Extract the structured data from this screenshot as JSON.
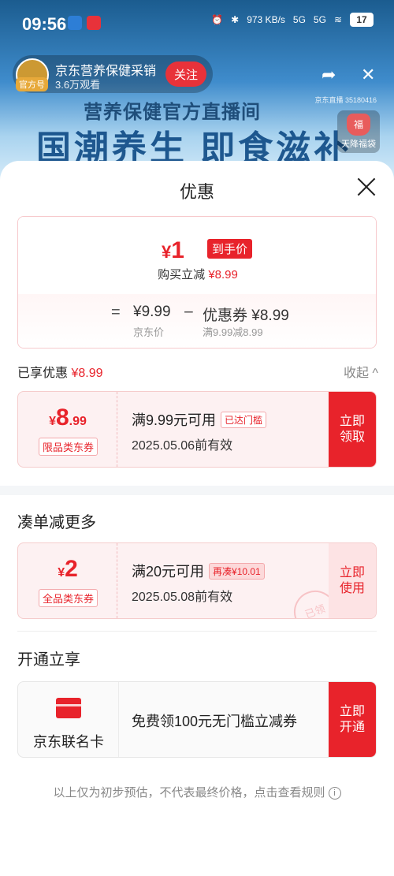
{
  "status": {
    "time": "09:56",
    "net_speed": "973 KB/s",
    "sig1": "5G",
    "sig2": "5G",
    "battery": "17"
  },
  "stream": {
    "official_badge": "官方号",
    "name": "京东营养保健采销",
    "viewers": "3.6万观看",
    "follow": "关注",
    "channel_id": "京东直播 35180416",
    "banner_sub": "营养保健官方直播间",
    "banner_main": "国潮养生 即食滋补",
    "lucky_bag_glyph": "福",
    "lucky_bag_label": "天降福袋"
  },
  "sheet": {
    "title": "优惠",
    "final_price": {
      "currency": "¥",
      "value": "1",
      "tag": "到手价"
    },
    "instant_label": "购买立减",
    "instant_amount": "¥8.99",
    "eq": "=",
    "jd_price": "¥9.99",
    "jd_label": "京东价",
    "minus": "−",
    "coupon_amount": "优惠券 ¥8.99",
    "coupon_cond": "满9.99减8.99",
    "enjoyed_label": "已享优惠",
    "enjoyed_amount": "¥8.99",
    "collapse": "收起 ^"
  },
  "coupon1": {
    "cur": "¥",
    "big": "8",
    "dec": ".99",
    "type": "限品类东券",
    "cond": "满9.99元可用",
    "tag": "已达门槛",
    "valid": "2025.05.06前有效",
    "btn": "立即领取"
  },
  "section2": {
    "title": "凑单减更多"
  },
  "coupon2": {
    "cur": "¥",
    "big": "2",
    "dec": "",
    "type": "全品类东券",
    "cond": "满20元可用",
    "tag": "再凑¥10.01",
    "valid": "2025.05.08前有效",
    "btn": "立即使用",
    "stamp": "已领"
  },
  "section3": {
    "title": "开通立享"
  },
  "card_offer": {
    "name": "京东联名卡",
    "desc": "免费领100元无门槛立减券",
    "btn": "立即开通"
  },
  "footer": {
    "note": "以上仅为初步预估，不代表最终价格，点击查看规则",
    "info_glyph": "i"
  },
  "colors": {
    "accent": "#e8232b",
    "pink_bg": "#fdf1f2"
  }
}
